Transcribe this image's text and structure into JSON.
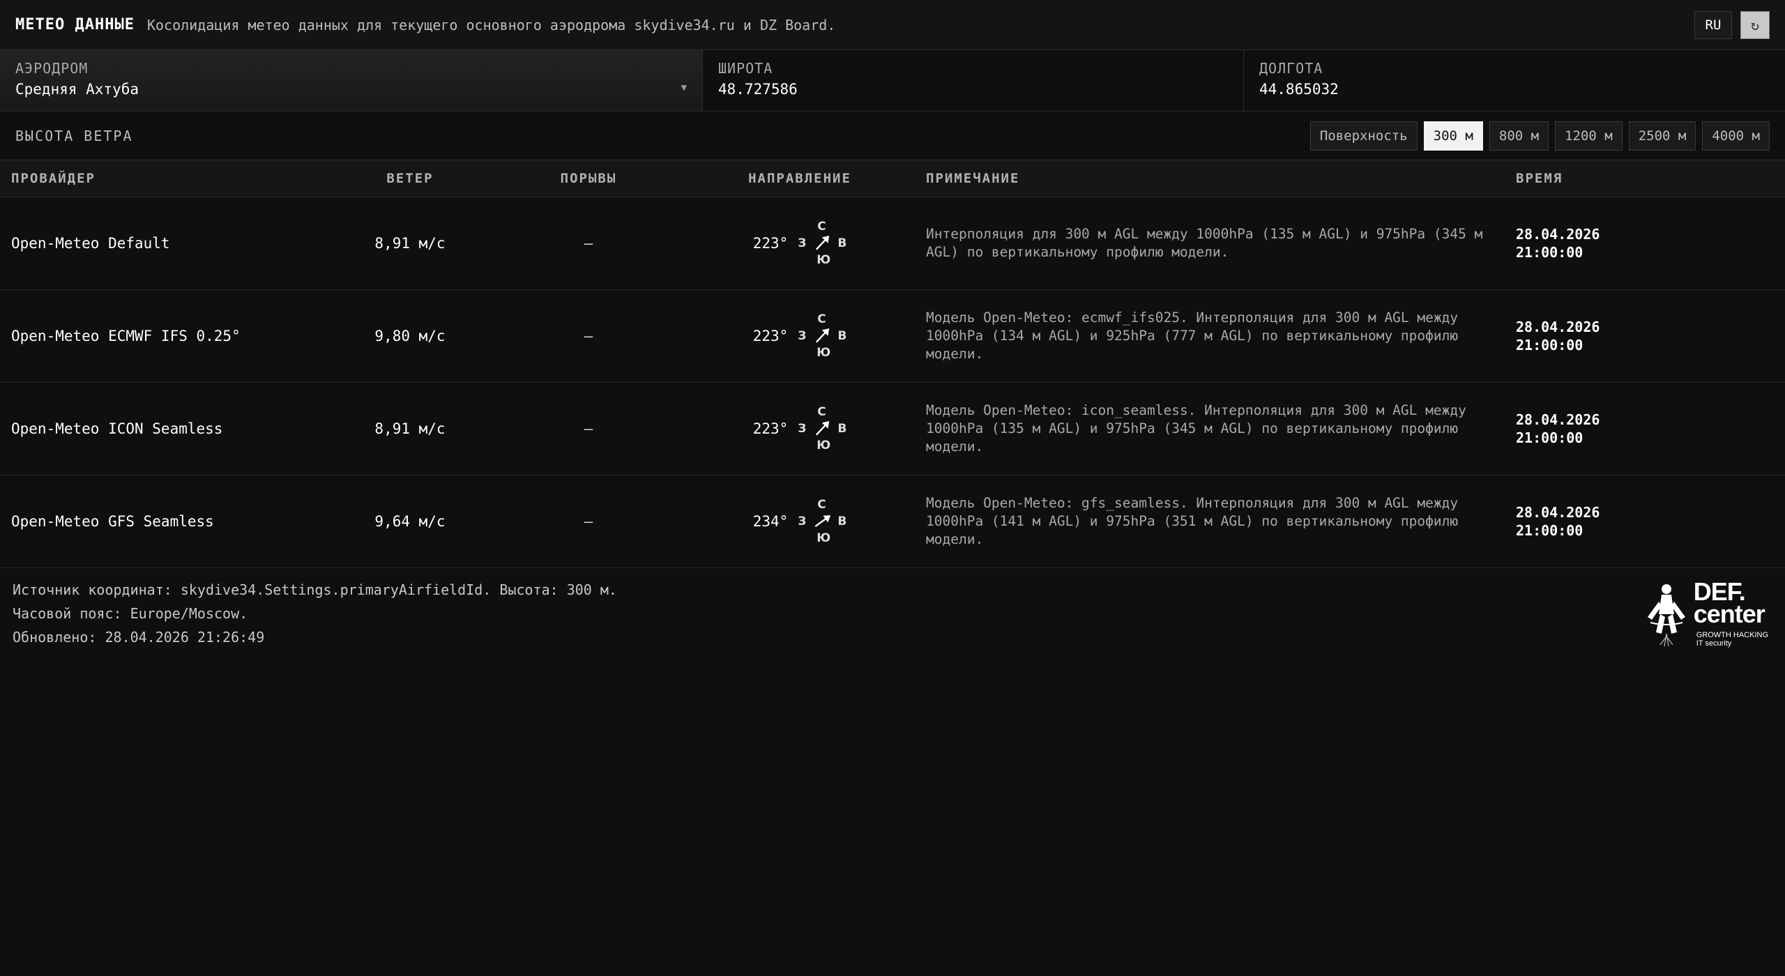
{
  "header": {
    "title": "МЕТЕО ДАННЫЕ",
    "subtitle": "Косолидация метео данных для текущего основного аэродрома skydive34.ru и DZ Board.",
    "lang": "RU",
    "refresh_icon": "refresh-icon"
  },
  "fields": {
    "airfield_label": "АЭРОДРОМ",
    "airfield_value": "Средняя Ахтуба",
    "lat_label": "ШИРОТА",
    "lat_value": "48.727586",
    "lon_label": "ДОЛГОТА",
    "lon_value": "44.865032"
  },
  "heights": {
    "label": "ВЫСОТА ВЕТРА",
    "options": [
      "Поверхность",
      "300 м",
      "800 м",
      "1200 м",
      "2500 м",
      "4000 м"
    ],
    "selected": "300 м"
  },
  "table": {
    "headers": [
      "ПРОВАЙДЕР",
      "ВЕТЕР",
      "ПОРЫВЫ",
      "НАПРАВЛЕНИЕ",
      "ПРИМЕЧАНИЕ",
      "ВРЕМЯ"
    ],
    "compass": {
      "n": "С",
      "s": "Ю",
      "w": "З",
      "e": "В"
    },
    "rows": [
      {
        "provider": "Open-Meteo Default",
        "wind": "8,91 м/с",
        "gusts": "—",
        "direction": "223°",
        "direction_deg": 223,
        "note": "Интерполяция для 300 м AGL между 1000hPa (135 м AGL) и 975hPa (345 м AGL) по вертикальному профилю модели.",
        "date": "28.04.2026",
        "time": "21:00:00"
      },
      {
        "provider": "Open-Meteo ECMWF IFS 0.25°",
        "wind": "9,80 м/с",
        "gusts": "—",
        "direction": "223°",
        "direction_deg": 223,
        "note": "Модель Open-Meteo: ecmwf_ifs025. Интерполяция для 300 м AGL между 1000hPa (134 м AGL) и 925hPa (777 м AGL) по вертикальному профилю модели.",
        "date": "28.04.2026",
        "time": "21:00:00"
      },
      {
        "provider": "Open-Meteo ICON Seamless",
        "wind": "8,91 м/с",
        "gusts": "—",
        "direction": "223°",
        "direction_deg": 223,
        "note": "Модель Open-Meteo: icon_seamless. Интерполяция для 300 м AGL между 1000hPa (135 м AGL) и 975hPa (345 м AGL) по вертикальному профилю модели.",
        "date": "28.04.2026",
        "time": "21:00:00"
      },
      {
        "provider": "Open-Meteo GFS Seamless",
        "wind": "9,64 м/с",
        "gusts": "—",
        "direction": "234°",
        "direction_deg": 234,
        "note": "Модель Open-Meteo: gfs_seamless. Интерполяция для 300 м AGL между 1000hPa (141 м AGL) и 975hPa (351 м AGL) по вертикальному профилю модели.",
        "date": "28.04.2026",
        "time": "21:00:00"
      }
    ]
  },
  "footer": {
    "line1": "Источник координат: skydive34.Settings.primaryAirfieldId. Высота: 300 м.",
    "line2": "Часовой пояс: Europe/Moscow.",
    "line3": "Обновлено: 28.04.2026 21:26:49"
  },
  "logo": {
    "main": "DEF. center",
    "line1": "DEF.",
    "line2": "center",
    "tag1": "GROWTH HACKING",
    "tag2": "IT security"
  },
  "colors": {
    "background": "#0f0f0f",
    "active_button": "#f2f2f2",
    "text": "#e8e8e8"
  }
}
